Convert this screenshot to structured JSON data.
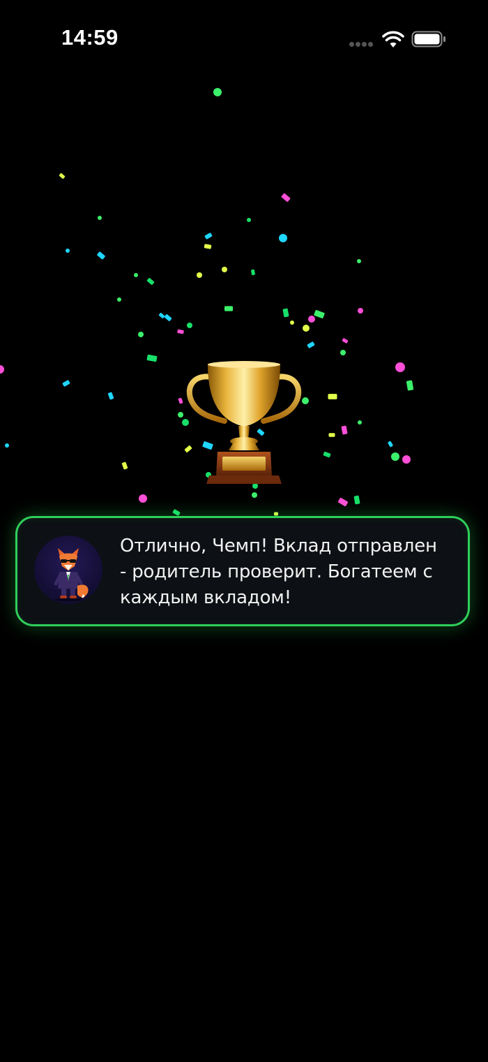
{
  "status_bar": {
    "time": "14:59",
    "icons": [
      "signal-dots-icon",
      "wifi-icon",
      "battery-icon"
    ]
  },
  "celebration": {
    "icon": "trophy-icon",
    "confetti_colors": [
      "#3cf06b",
      "#e3ff4a",
      "#ff4fd8",
      "#1fd6ff",
      "#18e06a"
    ]
  },
  "message": {
    "avatar_icon": "fox-mascot-icon",
    "text": "Отлично, Чемп! Вклад отправлен - родитель проверит. Богатеем с каждым вкладом!"
  },
  "colors": {
    "background": "#000000",
    "accent_border": "#2fcf5a",
    "card_background": "#0d1014"
  }
}
